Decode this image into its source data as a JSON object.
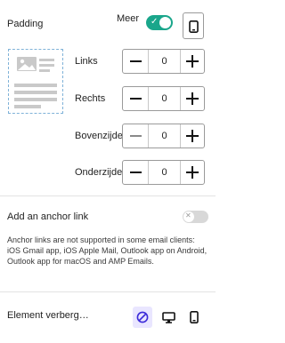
{
  "padding": {
    "title": "Padding",
    "more_label": "Meer",
    "more_enabled": true,
    "toggle_color": "#1aa68b",
    "rows": [
      {
        "label": "Links",
        "value": "0"
      },
      {
        "label": "Rechts",
        "value": "0"
      },
      {
        "label": "Bovenzijde",
        "value": "0"
      },
      {
        "label": "Onderzijde",
        "value": "0"
      }
    ]
  },
  "anchor": {
    "title": "Add an anchor link",
    "enabled": false,
    "note": "Anchor links are not supported in some email clients: iOS Gmail app, iOS Apple Mail, Outlook app on Android, Outlook app for macOS and AMP Emails."
  },
  "hide_element": {
    "title": "Element verberg…",
    "active_accent": "#3b2bd9",
    "options": [
      "hide-icon",
      "desktop-icon",
      "mobile-icon"
    ]
  }
}
